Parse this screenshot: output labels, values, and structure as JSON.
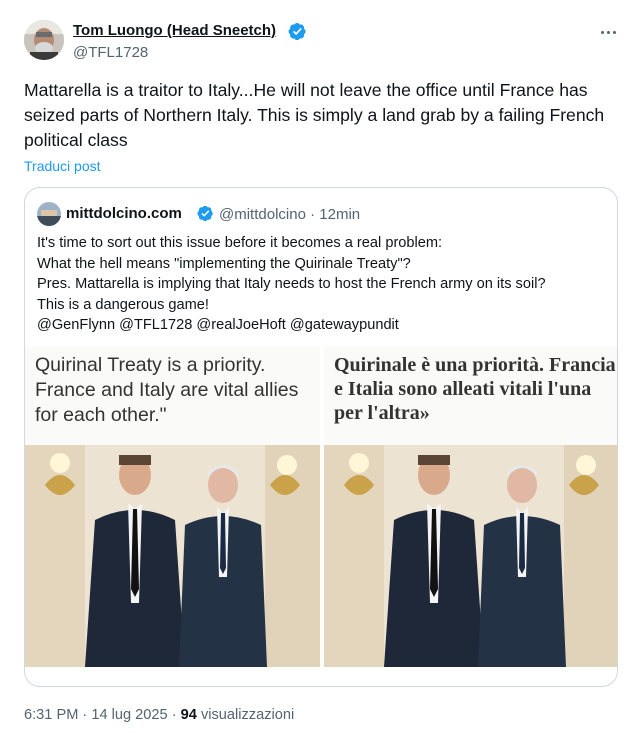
{
  "author": {
    "name": "Tom Luongo (Head Sneetch)",
    "handle": "@TFL1728"
  },
  "tweet": {
    "text": "Mattarella is a traitor to Italy...He will not leave the office until France has seized parts of Northern Italy.  This is simply a land grab by a failing French political class",
    "translate_label": "Traduci post"
  },
  "quote": {
    "name": "mittdolcino.com",
    "handle": "@mittdolcino",
    "separator": "·",
    "time": "12min",
    "lines": [
      "It's time to sort out this issue before it becomes a real problem:",
      "What the hell means \"implementing the Quirinale Treaty\"?",
      "Pres. Mattarella is implying that Italy needs to host the French army on its soil?",
      "This is a dangerous game!",
      "@GenFlynn @TFL1728 @realJoeHoft @gatewaypundit"
    ],
    "image_captions": {
      "left": "Quirinal Treaty is a priority. France and Italy are vital allies for each other.\"",
      "right": "Quirinale è una priorità. Francia e Italia sono alleati vitali l'una per l'altra»"
    }
  },
  "footer": {
    "time": "6:31 PM",
    "dot1": "·",
    "date": "14 lug 2025",
    "dot2": "·",
    "views": "94",
    "views_label": "visualizzazioni"
  },
  "icons": {
    "verified": "verified-badge-icon",
    "more": "more-dots-icon"
  },
  "colors": {
    "accent": "#1d9bf0",
    "secondary_text": "#536471",
    "border": "#cfd9de"
  }
}
